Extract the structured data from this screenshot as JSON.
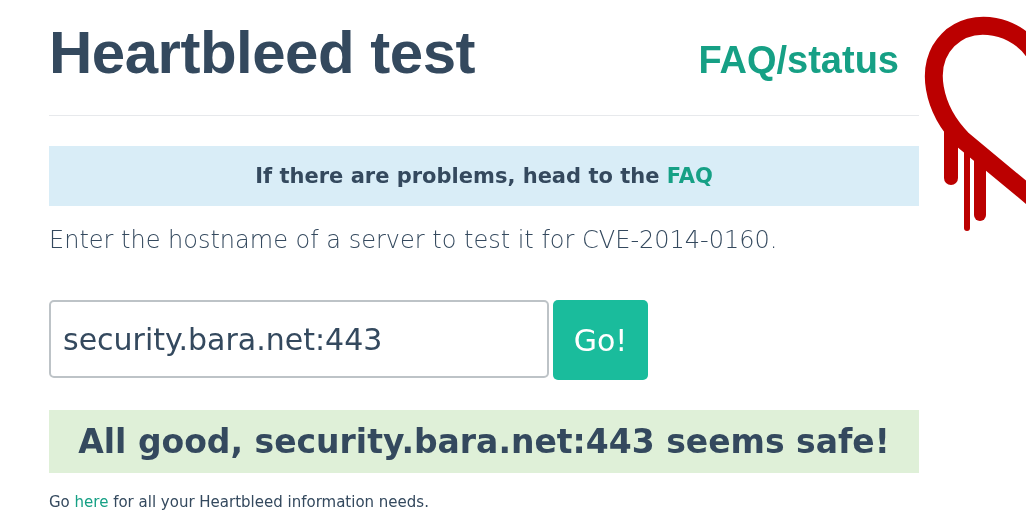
{
  "header": {
    "title": "Heartbleed test",
    "link": "FAQ/status"
  },
  "notice": {
    "text": "If there are problems, head to the ",
    "link": "FAQ"
  },
  "lead": "Enter the hostname of a server to test it for CVE-2014-0160.",
  "form": {
    "value": "security.bara.net:443",
    "button": "Go!"
  },
  "result": {
    "kind": "safe",
    "text": "All good, security.bara.net:443 seems safe!"
  },
  "footer": {
    "before": "Go ",
    "link": "here",
    "after": " for all your Heartbleed information needs."
  }
}
